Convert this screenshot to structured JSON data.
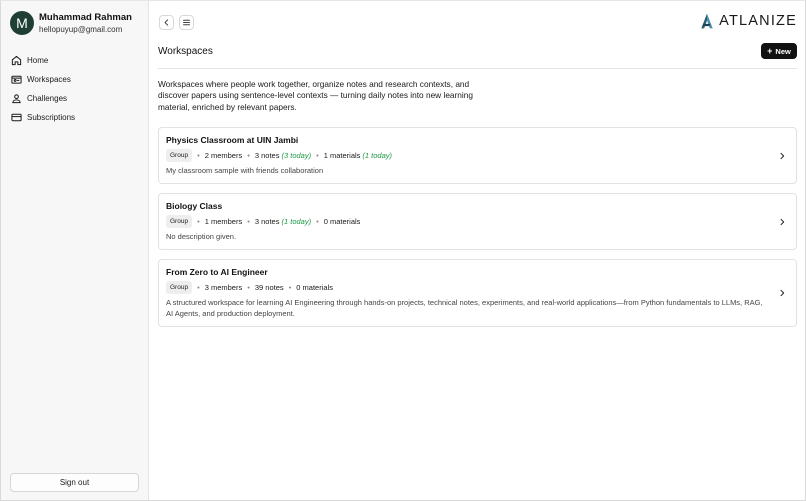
{
  "user": {
    "initial": "M",
    "name": "Muhammad Rahman",
    "email": "hellopuyup@gmail.com"
  },
  "sidebar": {
    "items": [
      {
        "label": "Home",
        "icon": "home-icon"
      },
      {
        "label": "Workspaces",
        "icon": "workspaces-icon"
      },
      {
        "label": "Challenges",
        "icon": "user-icon"
      },
      {
        "label": "Subscriptions",
        "icon": "credit-card-icon"
      }
    ],
    "signout_label": "Sign out"
  },
  "header": {
    "brand": "ATLANIZE",
    "title": "Workspaces",
    "new_label": "New"
  },
  "intro": "Workspaces where people work together, organize notes and research contexts, and discover papers using sentence-level contexts — turning daily notes into new learning material, enriched by relevant papers.",
  "workspaces": [
    {
      "title": "Physics Classroom at UIN Jambi",
      "badge": "Group",
      "members": "2 members",
      "notes": "3 notes",
      "notes_today": "(3 today)",
      "materials": "1 materials",
      "materials_today": "(1 today)",
      "description": "My classroom sample with friends collaboration"
    },
    {
      "title": "Biology Class",
      "badge": "Group",
      "members": "1 members",
      "notes": "3 notes",
      "notes_today": "(1 today)",
      "materials": "0 materials",
      "materials_today": "",
      "description": "No description given."
    },
    {
      "title": "From Zero to AI Engineer",
      "badge": "Group",
      "members": "3 members",
      "notes": "39 notes",
      "notes_today": "",
      "materials": "0 materials",
      "materials_today": "",
      "description": "A structured workspace for learning AI Engineering through hands-on projects, technical notes, experiments, and real-world applications—from Python fundamentals to LLMs, RAG, AI Agents, and production deployment."
    }
  ],
  "colors": {
    "avatar_bg": "#1f3f35",
    "primary_button": "#111111",
    "today_green": "#1e9a45"
  }
}
